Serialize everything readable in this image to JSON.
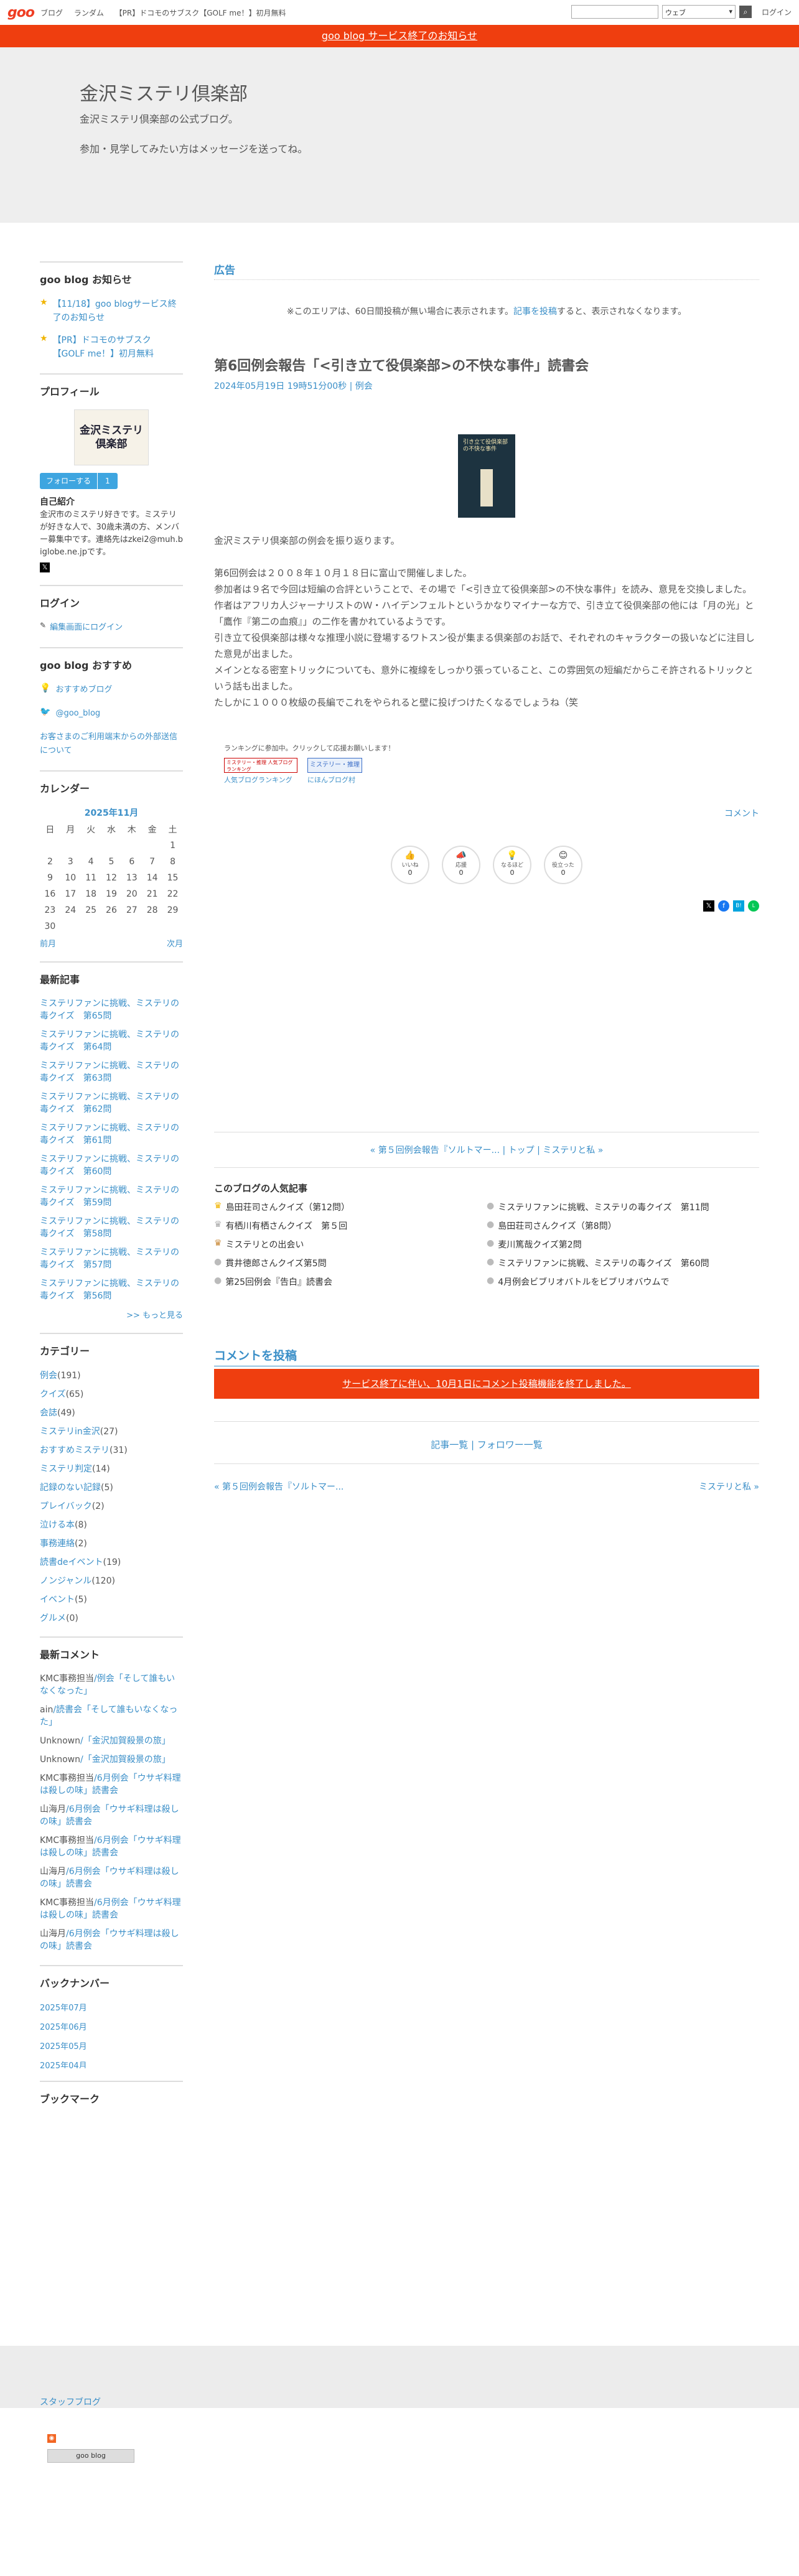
{
  "topbar": {
    "logo": "goo",
    "links": [
      "ブログ",
      "ランダム",
      "【PR】ドコモのサブスク【GOLF me！】初月無料"
    ],
    "select": "ウェブ",
    "login": "ログイン"
  },
  "notice": "goo blog サービス終了のお知らせ",
  "blog": {
    "title": "金沢ミステリ倶楽部",
    "desc1": "金沢ミステリ倶楽部の公式ブログ。",
    "desc2": "参加・見学してみたい方はメッセージを送ってね。"
  },
  "sidebar": {
    "news_title": "goo blog お知らせ",
    "news": [
      "【11/18】goo blogサービス終了のお知らせ",
      "【PR】ドコモのサブスク【GOLF me！】初月無料"
    ],
    "profile_title": "プロフィール",
    "avatar_text": "金沢ミステリ倶楽部",
    "follow": "フォローする",
    "follow_count": "1",
    "self_title": "自己紹介",
    "self_text": "金沢市のミステリ好きです。ミステリが好きな人で、30歳未満の方、メンバー募集中です。連絡先はzkei2@muh.biglobe.ne.jpです。",
    "login_title": "ログイン",
    "login_link": "編集画面にログイン",
    "recommend_title": "goo blog おすすめ",
    "recommend": [
      "おすすめブログ",
      "@goo_blog",
      "お客さまのご利用端末からの外部送信について"
    ],
    "calendar_title": "カレンダー",
    "cal_month": "2025年11月",
    "cal_days": [
      "日",
      "月",
      "火",
      "水",
      "木",
      "金",
      "土"
    ],
    "cal_rows": [
      [
        "",
        "",
        "",
        "",
        "",
        "",
        "1"
      ],
      [
        "2",
        "3",
        "4",
        "5",
        "6",
        "7",
        "8"
      ],
      [
        "9",
        "10",
        "11",
        "12",
        "13",
        "14",
        "15"
      ],
      [
        "16",
        "17",
        "18",
        "19",
        "20",
        "21",
        "22"
      ],
      [
        "23",
        "24",
        "25",
        "26",
        "27",
        "28",
        "29"
      ],
      [
        "30",
        "",
        "",
        "",
        "",
        "",
        ""
      ]
    ],
    "cal_prev": "前月",
    "cal_next": "次月",
    "recent_title": "最新記事",
    "recent": [
      "ミステリファンに挑戦、ミステリの毒クイズ　第65問",
      "ミステリファンに挑戦、ミステリの毒クイズ　第64問",
      "ミステリファンに挑戦、ミステリの毒クイズ　第63問",
      "ミステリファンに挑戦、ミステリの毒クイズ　第62問",
      "ミステリファンに挑戦、ミステリの毒クイズ　第61問",
      "ミステリファンに挑戦、ミステリの毒クイズ　第60問",
      "ミステリファンに挑戦、ミステリの毒クイズ　第59問",
      "ミステリファンに挑戦、ミステリの毒クイズ　第58問",
      "ミステリファンに挑戦、ミステリの毒クイズ　第57問",
      "ミステリファンに挑戦、ミステリの毒クイズ　第56問"
    ],
    "more": ">> もっと見る",
    "cat_title": "カテゴリー",
    "cats": [
      {
        "n": "例会",
        "c": "(191)"
      },
      {
        "n": "クイズ",
        "c": "(65)"
      },
      {
        "n": "会誌",
        "c": "(49)"
      },
      {
        "n": "ミステリin金沢",
        "c": "(27)"
      },
      {
        "n": "おすすめミステリ",
        "c": "(31)"
      },
      {
        "n": "ミステリ判定",
        "c": "(14)"
      },
      {
        "n": "記録のない記録",
        "c": "(5)"
      },
      {
        "n": "プレイバック",
        "c": "(2)"
      },
      {
        "n": "泣ける本",
        "c": "(8)"
      },
      {
        "n": "事務連絡",
        "c": "(2)"
      },
      {
        "n": "読書deイベント",
        "c": "(19)"
      },
      {
        "n": "ノンジャンル",
        "c": "(120)"
      },
      {
        "n": "イベント",
        "c": "(5)"
      },
      {
        "n": "グルメ",
        "c": "(0)"
      }
    ],
    "cmt_title": "最新コメント",
    "cmts": [
      {
        "u": "KMC事務担当",
        "t": "/例会「そして誰もいなくなった」"
      },
      {
        "u": "ain",
        "t": "/読書会「そして誰もいなくなった」"
      },
      {
        "u": "Unknown",
        "t": "/「金沢加賀殺景の旅」"
      },
      {
        "u": "Unknown",
        "t": "/「金沢加賀殺景の旅」"
      },
      {
        "u": "KMC事務担当",
        "t": "/6月例会「ウサギ料理は殺しの味」読書会"
      },
      {
        "u": "山海月",
        "t": "/6月例会「ウサギ料理は殺しの味」読書会"
      },
      {
        "u": "KMC事務担当",
        "t": "/6月例会「ウサギ料理は殺しの味」読書会"
      },
      {
        "u": "山海月",
        "t": "/6月例会「ウサギ料理は殺しの味」読書会"
      },
      {
        "u": "KMC事務担当",
        "t": "/6月例会「ウサギ料理は殺しの味」読書会"
      },
      {
        "u": "山海月",
        "t": "/6月例会「ウサギ料理は殺しの味」読書会"
      }
    ],
    "back_title": "バックナンバー",
    "back": [
      "2025年07月",
      "2025年06月",
      "2025年05月",
      "2025年04月"
    ],
    "bookmark_title": "ブックマーク",
    "staff": "スタッフブログ",
    "badge": "goo blog"
  },
  "main": {
    "ad_title": "広告",
    "ad_note_pre": "※このエリアは、60日間投稿が無い場合に表示されます。",
    "ad_note_link": "記事を投稿",
    "ad_note_post": "すると、表示されなくなります。",
    "entry_title": "第6回例会報告「<引き立て役倶楽部>の不快な事件」読書会",
    "entry_date": "2024年05月19日 19時51分00秒",
    "entry_cat": "例会",
    "book_text": "引き立て役倶楽部の不快な事件",
    "p1": "金沢ミステリ倶楽部の例会を振り返ります。",
    "p2": "第6回例会は２００８年１０月１８日に富山で開催しました。",
    "p3": "参加者は９名で今回は短編の合評ということで、その場で「<引き立て役倶楽部>の不快な事件」を読み、意見を交換しました。",
    "p4": "作者はアフリカ人ジャーナリストのＷ・ハイデンフェルトというかなりマイナーな方で、引き立て役倶楽部の他には「月の光」と「鷹作『第二の血痕』」の二作を書かれているようです。",
    "p5": "引き立て役倶楽部は様々な推理小説に登場するワトスン役が集まる倶楽部のお話で、それぞれのキャラクターの扱いなどに注目した意見が出ました。",
    "p6": "メインとなる密室トリックについても、意外に複線をしっかり張っていること、この雰囲気の短編だからこそ許されるトリックという話も出ました。",
    "p7": "たしかに１０００枚級の長編でこれをやられると壁に投げつけたくなるでしょうね（笑",
    "rank_note": "ランキングに参加中。クリックして応援お願いします！",
    "rank1": "人気ブログランキング",
    "rank2": "にほんブログ村",
    "rank_badge1": "ミステリー・推理 人気ブログランキング",
    "rank_badge2": "ミステリー・推理",
    "comment_link": "コメント",
    "reactions": [
      {
        "l": "いいね",
        "c": "0"
      },
      {
        "l": "応援",
        "c": "0"
      },
      {
        "l": "なるほど",
        "c": "0"
      },
      {
        "l": "役立った",
        "c": "0"
      }
    ],
    "nav": {
      "prev": "« 第５回例会報告『ソルトマー…','top':'トップ",
      "top": "トップ",
      "next": "ミステリと私 »"
    },
    "nav_prev": "« 第５回例会報告『ソルトマー...",
    "nav_top": "トップ",
    "nav_next": "ミステリと私 »",
    "popular_title": "このブログの人気記事",
    "popular_left": [
      "島田荘司さんクイズ（第12問）",
      "有栖川有栖さんクイズ　第５回",
      "ミステリとの出会い",
      "貫井徳郎さんクイズ第5問",
      "第25回例会『告白』読書会"
    ],
    "popular_right": [
      "ミステリファンに挑戦、ミステリの毒クイズ　第11問",
      "島田荘司さんクイズ（第8問）",
      "麦川篤哉クイズ第2問",
      "ミステリファンに挑戦、ミステリの毒クイズ　第60問",
      "4月例会ビブリオバトルをビブリオバウムで"
    ],
    "post_title": "コメントを投稿",
    "post_notice": "サービス終了に伴い、10月1日にコメント投稿機能を終了しました。",
    "list_links": "記事一覧 | フォロワー一覧",
    "bottom_prev": "« 第５回例会報告『ソルトマー...",
    "bottom_next": "ミステリと私 »"
  },
  "colors": {
    "accent": "#3b8fc8",
    "brand": "#ef3e24",
    "notice_bg": "#ef3e0f"
  }
}
